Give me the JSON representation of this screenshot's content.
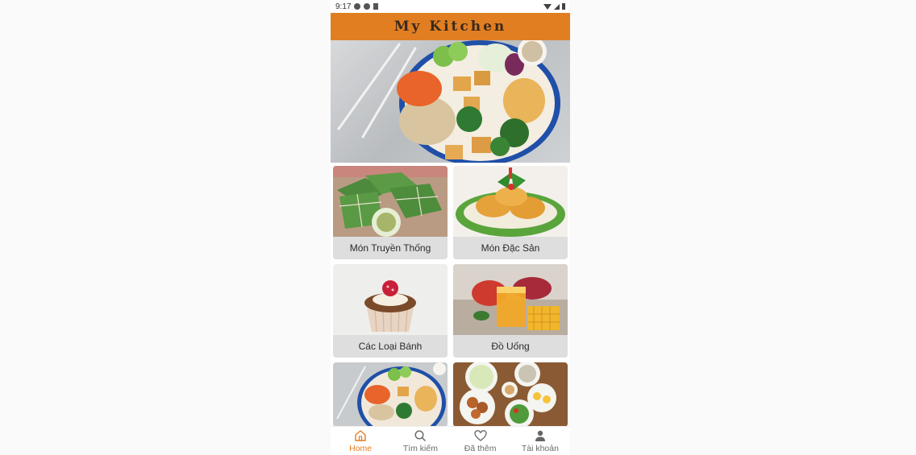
{
  "status_bar": {
    "time": "9:17"
  },
  "app_bar": {
    "title": "My Kitchen"
  },
  "categories": [
    {
      "label": "Món Truyền Thống"
    },
    {
      "label": "Món Đặc Sản"
    },
    {
      "label": "Các Loại Bánh"
    },
    {
      "label": "Đồ Uống"
    }
  ],
  "bottom_nav": {
    "items": [
      {
        "label": "Home",
        "icon": "home-icon",
        "active": true
      },
      {
        "label": "Tìm kiếm",
        "icon": "search-icon",
        "active": false
      },
      {
        "label": "Đã thêm",
        "icon": "heart-icon",
        "active": false
      },
      {
        "label": "Tài khoản",
        "icon": "user-icon",
        "active": false
      }
    ]
  },
  "colors": {
    "accent": "#e27e22",
    "title_text": "#3a2a1c",
    "card_bg": "#dedede"
  }
}
